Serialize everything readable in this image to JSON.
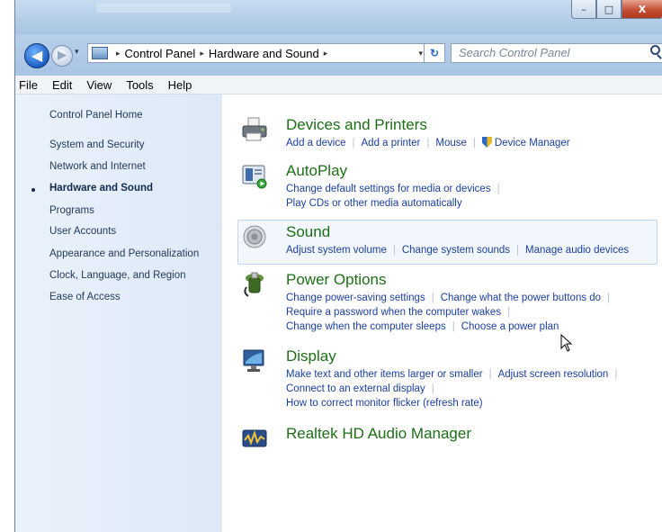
{
  "window": {
    "buttons": {
      "minimize": "–",
      "maximize": "□",
      "close": "X"
    }
  },
  "nav": {
    "back_glyph": "◀",
    "forward_glyph": "▶",
    "recent_glyph": "▾",
    "address": {
      "crumbs": [
        "Control Panel",
        "Hardware and Sound"
      ],
      "separator": "▸",
      "dropdown_glyph": "▾",
      "refresh_glyph": "↻"
    },
    "search_placeholder": "Search Control Panel"
  },
  "menu": [
    "File",
    "Edit",
    "View",
    "Tools",
    "Help"
  ],
  "sidebar": {
    "home": "Control Panel Home",
    "items": [
      {
        "label": "System and Security",
        "current": false
      },
      {
        "label": "Network and Internet",
        "current": false
      },
      {
        "label": "Hardware and Sound",
        "current": true
      },
      {
        "label": "Programs",
        "current": false
      },
      {
        "label": "User Accounts",
        "current": false
      },
      {
        "label": "Appearance and Personalization",
        "current": false
      },
      {
        "label": "Clock, Language, and Region",
        "current": false
      },
      {
        "label": "Ease of Access",
        "current": false
      }
    ]
  },
  "categories": [
    {
      "title": "Devices and Printers",
      "icon": "printer-icon",
      "link_lines": [
        [
          "Add a device",
          "Add a printer",
          "Mouse",
          "Device Manager"
        ]
      ]
    },
    {
      "title": "AutoPlay",
      "icon": "autoplay-icon",
      "link_lines": [
        [
          "Change default settings for media or devices"
        ],
        [
          "Play CDs or other media automatically"
        ]
      ]
    },
    {
      "title": "Sound",
      "icon": "speaker-icon",
      "link_lines": [
        [
          "Adjust system volume",
          "Change system sounds",
          "Manage audio devices"
        ]
      ]
    },
    {
      "title": "Power Options",
      "icon": "power-options-icon",
      "link_lines": [
        [
          "Change power-saving settings",
          "Change what the power buttons do"
        ],
        [
          "Require a password when the computer wakes"
        ],
        [
          "Change when the computer sleeps",
          "Choose a power plan"
        ]
      ]
    },
    {
      "title": "Display",
      "icon": "monitor-icon",
      "link_lines": [
        [
          "Make text and other items larger or smaller",
          "Adjust screen resolution"
        ],
        [
          "Connect to an external display"
        ],
        [
          "How to correct monitor flicker (refresh rate)"
        ]
      ]
    },
    {
      "title": "Realtek HD Audio Manager",
      "icon": "audio-manager-icon",
      "link_lines": []
    }
  ]
}
